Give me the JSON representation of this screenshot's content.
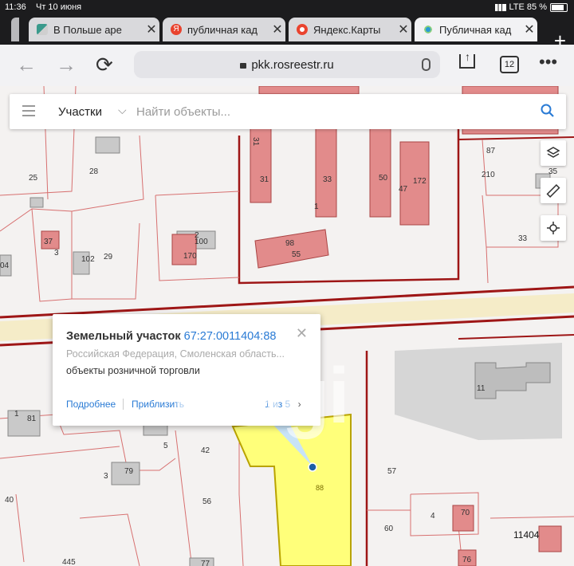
{
  "status_bar": {
    "time": "11:36",
    "date": "Чт 10 июня",
    "network": "LTE 85 %"
  },
  "tabs": [
    {
      "label": "В Польше аре"
    },
    {
      "label": "публичная кад"
    },
    {
      "label": "Яндекс.Карты"
    },
    {
      "label": "Публичная кад"
    }
  ],
  "toolbar": {
    "url": "pkk.rosreestr.ru",
    "tab_count": "12"
  },
  "search": {
    "category": "Участки",
    "placeholder": "Найти объекты..."
  },
  "popup": {
    "title": "Земельный участок",
    "cadastral_number": "67:27:0011404:88",
    "address": "Российская Федерация, Смоленская область...",
    "usage": "объекты розничной торговли",
    "more_link": "Подробнее",
    "zoom_link": "Приблизить",
    "pager": "1 из 5"
  },
  "watermark": "etagi",
  "map_labels": {
    "l25": "25",
    "l28": "28",
    "l31": "31",
    "l33": "33",
    "l50": "50",
    "l47": "47",
    "l172": "172",
    "l1a": "1",
    "l98": "98",
    "l55": "55",
    "l87": "87",
    "l35": "35",
    "l210": "210",
    "l33b": "33",
    "l100": "100",
    "l170": "170",
    "l2": "2",
    "l102": "102",
    "l29": "29",
    "l3": "3",
    "l37": "37",
    "l04": "04",
    "l11": "11",
    "l1b": "1",
    "l81": "81",
    "l5": "5",
    "l42": "42",
    "l79": "79",
    "l3b": "3",
    "l40": "40",
    "l56": "56",
    "l88": "88",
    "l57": "57",
    "l4": "4",
    "l60": "60",
    "l11404": "11404",
    "l445": "445",
    "l77": "77",
    "l70": "70",
    "l76": "76"
  }
}
